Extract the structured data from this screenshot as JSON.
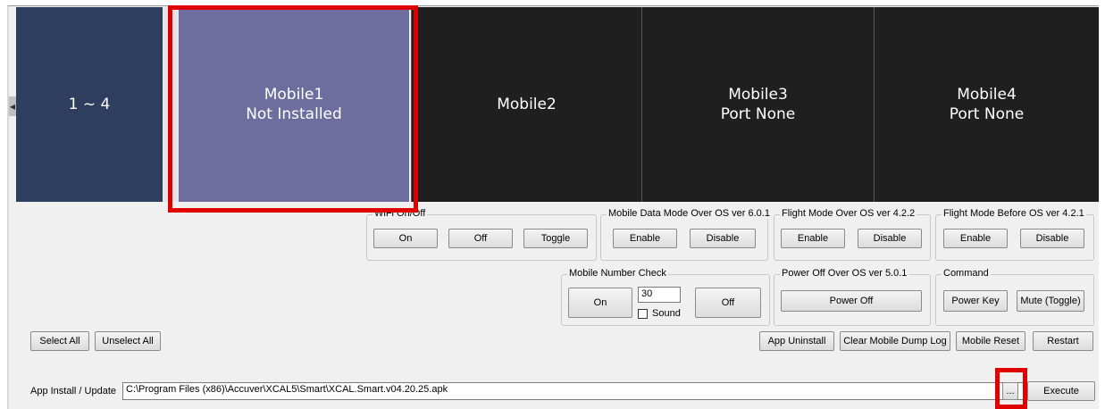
{
  "tiles": {
    "range": "1 ~ 4",
    "mobile1": {
      "name": "Mobile1",
      "status": "Not Installed"
    },
    "mobile2": {
      "name": "Mobile2"
    },
    "mobile3": {
      "name": "Mobile3",
      "status": "Port None"
    },
    "mobile4": {
      "name": "Mobile4",
      "status": "Port None"
    }
  },
  "groups": {
    "wifi": {
      "title": "WiFi On/Off",
      "on": "On",
      "off": "Off",
      "toggle": "Toggle"
    },
    "mobile_data": {
      "title": "Mobile Data Mode Over OS ver 6.0.1",
      "enable": "Enable",
      "disable": "Disable"
    },
    "flight_new": {
      "title": "Flight Mode Over OS ver 4.2.2",
      "enable": "Enable",
      "disable": "Disable"
    },
    "flight_old": {
      "title": "Flight Mode  Before OS ver 4.2.1",
      "enable": "Enable",
      "disable": "Disable"
    },
    "number_check": {
      "title": "Mobile Number Check",
      "on": "On",
      "value": "30",
      "sound": "Sound",
      "off": "Off"
    },
    "power_off": {
      "title": "Power Off Over OS ver 5.0.1",
      "button": "Power Off"
    },
    "command": {
      "title": "Command",
      "power_key": "Power Key",
      "mute": "Mute (Toggle)"
    }
  },
  "actions": {
    "select_all": "Select All",
    "unselect_all": "Unselect All",
    "app_uninstall": "App Uninstall",
    "clear_dump": "Clear Mobile Dump Log",
    "mobile_reset": "Mobile Reset",
    "restart": "Restart"
  },
  "install": {
    "label": "App Install / Update",
    "path": "C:\\Program Files (x86)\\Accuver\\XCAL5\\Smart\\XCAL.Smart.v04.20.25.apk",
    "browse": "...",
    "execute": "Execute"
  },
  "colors": {
    "highlight": "#e00000",
    "tile_selected": "#6e6e9e",
    "tile_range": "#2e3e5e",
    "tile_dark": "#1f1f1f"
  }
}
